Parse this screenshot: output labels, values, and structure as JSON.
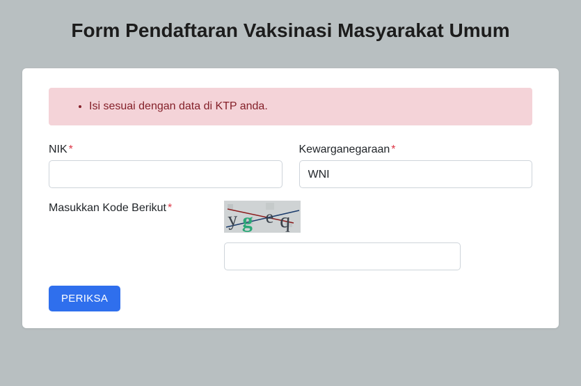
{
  "page": {
    "title": "Form Pendaftaran Vaksinasi Masyarakat Umum"
  },
  "alert": {
    "items": [
      "Isi sesuai dengan data di KTP anda."
    ]
  },
  "form": {
    "nik": {
      "label": "NIK",
      "required_mark": "*",
      "value": ""
    },
    "kewarganegaraan": {
      "label": "Kewarganegaraan",
      "required_mark": "*",
      "selected": "WNI"
    },
    "captcha": {
      "label": "Masukkan Kode Berikut",
      "required_mark": "*",
      "code_display": "yg eq",
      "value": ""
    },
    "submit_label": "PERIKSA"
  }
}
